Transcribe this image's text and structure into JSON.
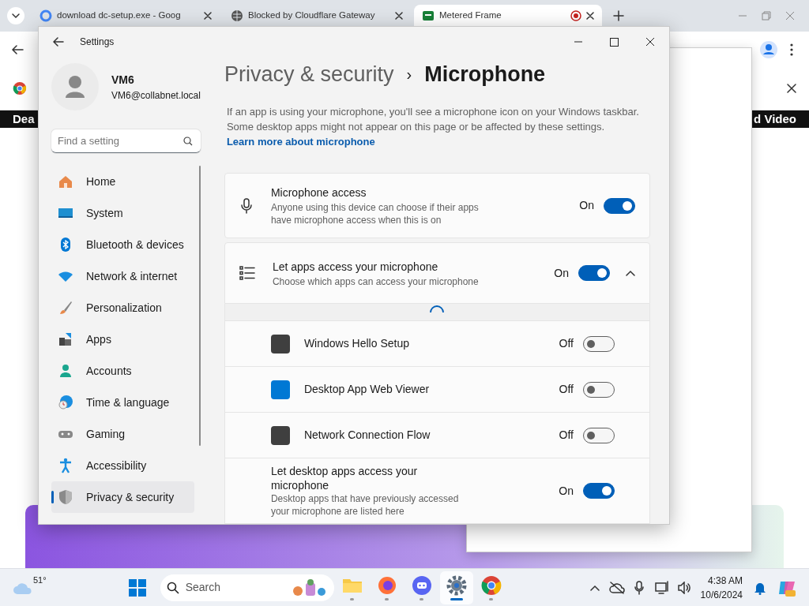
{
  "browser": {
    "tabs": [
      {
        "title": "download dc-setup.exe - Goog",
        "selected": false
      },
      {
        "title": "Blocked by Cloudflare Gateway",
        "selected": false
      },
      {
        "title": "Metered Frame",
        "selected": true
      }
    ],
    "strip_left": "Dea",
    "strip_right": "d Video"
  },
  "settings": {
    "title": "Settings",
    "user": {
      "name": "VM6",
      "email": "VM6@collabnet.local"
    },
    "search": {
      "placeholder": "Find a setting"
    },
    "nav": [
      {
        "label": "Home",
        "selected": false
      },
      {
        "label": "System",
        "selected": false
      },
      {
        "label": "Bluetooth & devices",
        "selected": false
      },
      {
        "label": "Network & internet",
        "selected": false
      },
      {
        "label": "Personalization",
        "selected": false
      },
      {
        "label": "Apps",
        "selected": false
      },
      {
        "label": "Accounts",
        "selected": false
      },
      {
        "label": "Time & language",
        "selected": false
      },
      {
        "label": "Gaming",
        "selected": false
      },
      {
        "label": "Accessibility",
        "selected": false
      },
      {
        "label": "Privacy & security",
        "selected": true
      }
    ],
    "breadcrumb": {
      "parent": "Privacy & security",
      "separator": "›",
      "current": "Microphone"
    },
    "description": "If an app is using your microphone, you'll see a microphone icon on your Windows taskbar. Some desktop apps might not appear on this page or be affected by these settings.",
    "learn_more": "Learn more about microphone",
    "rows": [
      {
        "kind": "card",
        "title": "Microphone access",
        "subtitle": "Anyone using this device can choose if their apps have microphone access when this is on",
        "state_label": "On",
        "on": true
      },
      {
        "kind": "expander",
        "title": "Let apps access your microphone",
        "subtitle": "Choose which apps can access your microphone",
        "state_label": "On",
        "on": true,
        "expanded": true,
        "loading": true
      },
      {
        "kind": "app",
        "title": "Windows Hello Setup",
        "state_label": "Off",
        "on": false,
        "color": "#3f3f3f"
      },
      {
        "kind": "app",
        "title": "Desktop App Web Viewer",
        "state_label": "Off",
        "on": false,
        "color": "#0078d4"
      },
      {
        "kind": "app",
        "title": "Network Connection Flow",
        "state_label": "Off",
        "on": false,
        "color": "#3f3f3f"
      },
      {
        "kind": "sub",
        "title": "Let desktop apps access your microphone",
        "subtitle": "Desktop apps that have previously accessed your microphone are listed here",
        "state_label": "On",
        "on": true
      }
    ]
  },
  "taskbar": {
    "weather": "51°",
    "search": {
      "placeholder": "Search"
    },
    "apps": [
      {
        "selected": false
      },
      {
        "selected": false
      },
      {
        "selected": false
      },
      {
        "selected": true
      },
      {
        "selected": false
      }
    ],
    "time": "4:38 AM",
    "date": "10/6/2024"
  }
}
